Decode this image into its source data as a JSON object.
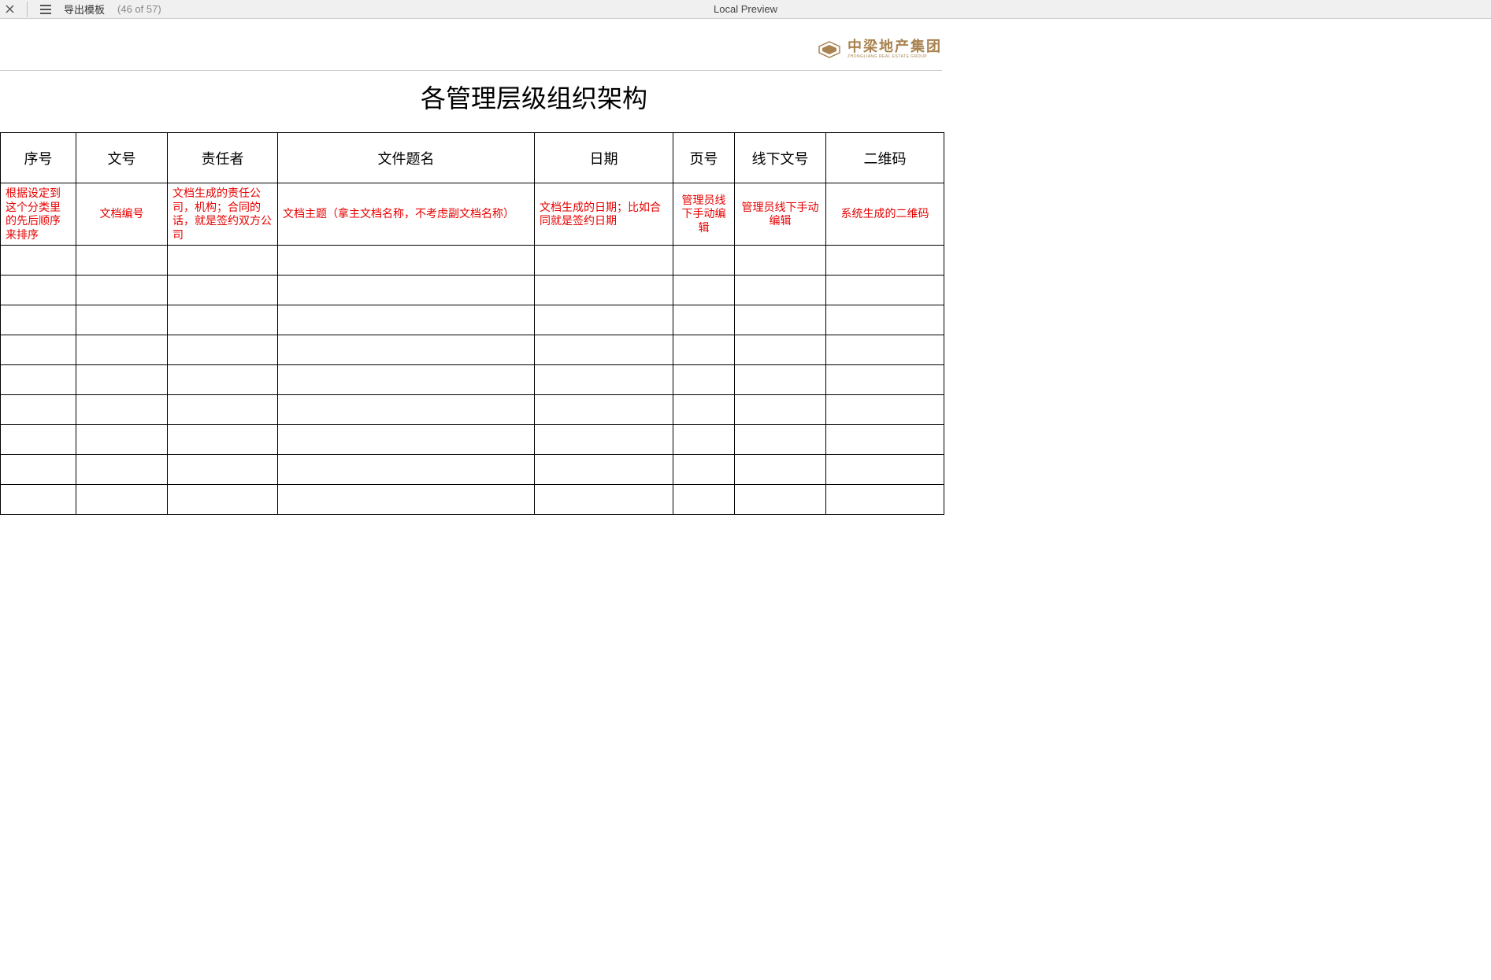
{
  "toolbar": {
    "doc_title": "导出模板",
    "counter": "(46 of 57)",
    "center_label": "Local Preview"
  },
  "logo": {
    "cn": "中梁地产集团",
    "en": "ZHONGLIANG REAL ESTATE GROUP"
  },
  "page_title": "各管理层级组织架构",
  "headers": [
    "序号",
    "文号",
    "责任者",
    "文件题名",
    "日期",
    "页号",
    "线下文号",
    "二维码"
  ],
  "descriptions": [
    "根据设定到这个分类里的先后顺序来排序",
    "文档编号",
    "文档生成的责任公司，机构；合同的话，就是签约双方公司",
    "文档主题（拿主文档名称，不考虑副文档名称）",
    "文档生成的日期；比如合同就是签约日期",
    "管理员线下手动编辑",
    "管理员线下手动编辑",
    "系统生成的二维码"
  ],
  "empty_rows": 9
}
